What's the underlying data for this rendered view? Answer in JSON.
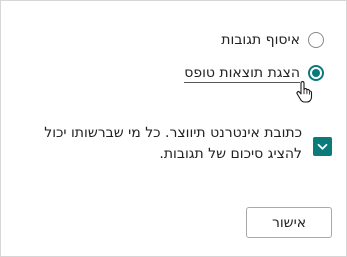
{
  "dialog": {
    "options": [
      {
        "label": "איסוף תגובות",
        "selected": false
      },
      {
        "label": "הצגת תוצאות טופס",
        "selected": true
      }
    ],
    "checkbox": {
      "label": "כתובת אינטרנט תיווצר. כל מי שברשותו יכול להציג סיכום של תגובות.",
      "checked": true
    },
    "ok_button_label": "אישור"
  },
  "colors": {
    "accent": "#0b7a7a",
    "border": "#d6d6d6"
  },
  "icons": {
    "cursor": "hand-pointer-icon"
  }
}
